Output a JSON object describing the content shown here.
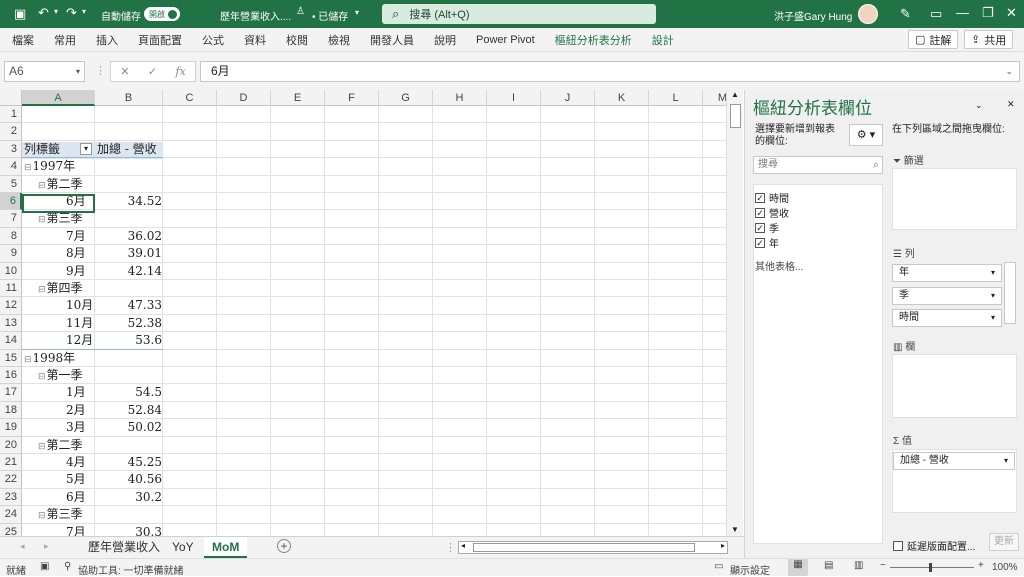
{
  "title_bar": {
    "autosave_label": "自動儲存",
    "autosave_state": "開啟",
    "doc_title": "歷年營業收入....",
    "save_status": "• 已儲存",
    "search_placeholder": "搜尋 (Alt+Q)",
    "user_name": "洪子盛Gary Hung"
  },
  "menu": {
    "items": [
      "檔案",
      "常用",
      "插入",
      "頁面配置",
      "公式",
      "資料",
      "校閱",
      "檢視",
      "開發人員",
      "說明",
      "Power Pivot",
      "樞紐分析表分析",
      "設計"
    ],
    "comment_label": "註解",
    "share_label": "共用"
  },
  "formula_bar": {
    "name_box": "A6",
    "fx_label": "fx",
    "formula_value": "6月"
  },
  "grid": {
    "columns": [
      "A",
      "B",
      "C",
      "D",
      "E",
      "F",
      "G",
      "H",
      "I",
      "J",
      "K",
      "L",
      "M"
    ],
    "rows": [
      "1",
      "2",
      "3",
      "4",
      "5",
      "6",
      "7",
      "8",
      "9",
      "10",
      "11",
      "12",
      "13",
      "14",
      "15",
      "16",
      "17",
      "18",
      "19",
      "20",
      "21",
      "22",
      "23",
      "24",
      "25"
    ],
    "cells": [
      {
        "r": 3,
        "col": "a",
        "text": "列標籤",
        "kind": "header"
      },
      {
        "r": 3,
        "col": "b",
        "text": "加總 - 營收",
        "kind": "header"
      },
      {
        "r": 4,
        "col": "a",
        "text": "1997年",
        "kind": "year"
      },
      {
        "r": 5,
        "col": "a",
        "text": "第二季",
        "kind": "quarter"
      },
      {
        "r": 6,
        "col": "a",
        "text": "6月",
        "kind": "month"
      },
      {
        "r": 6,
        "col": "b",
        "text": "34.52",
        "kind": "value"
      },
      {
        "r": 7,
        "col": "a",
        "text": "第三季",
        "kind": "quarter"
      },
      {
        "r": 8,
        "col": "a",
        "text": "7月",
        "kind": "month"
      },
      {
        "r": 8,
        "col": "b",
        "text": "36.02",
        "kind": "value"
      },
      {
        "r": 9,
        "col": "a",
        "text": "8月",
        "kind": "month"
      },
      {
        "r": 9,
        "col": "b",
        "text": "39.01",
        "kind": "value"
      },
      {
        "r": 10,
        "col": "a",
        "text": "9月",
        "kind": "month"
      },
      {
        "r": 10,
        "col": "b",
        "text": "42.14",
        "kind": "value"
      },
      {
        "r": 11,
        "col": "a",
        "text": "第四季",
        "kind": "quarter"
      },
      {
        "r": 12,
        "col": "a",
        "text": "10月",
        "kind": "month"
      },
      {
        "r": 12,
        "col": "b",
        "text": "47.33",
        "kind": "value"
      },
      {
        "r": 13,
        "col": "a",
        "text": "11月",
        "kind": "month"
      },
      {
        "r": 13,
        "col": "b",
        "text": "52.38",
        "kind": "value"
      },
      {
        "r": 14,
        "col": "a",
        "text": "12月",
        "kind": "month"
      },
      {
        "r": 14,
        "col": "b",
        "text": "53.6",
        "kind": "value"
      },
      {
        "r": 15,
        "col": "a",
        "text": "1998年",
        "kind": "year"
      },
      {
        "r": 16,
        "col": "a",
        "text": "第一季",
        "kind": "quarter"
      },
      {
        "r": 17,
        "col": "a",
        "text": "1月",
        "kind": "month"
      },
      {
        "r": 17,
        "col": "b",
        "text": "54.5",
        "kind": "value"
      },
      {
        "r": 18,
        "col": "a",
        "text": "2月",
        "kind": "month"
      },
      {
        "r": 18,
        "col": "b",
        "text": "52.84",
        "kind": "value"
      },
      {
        "r": 19,
        "col": "a",
        "text": "3月",
        "kind": "month"
      },
      {
        "r": 19,
        "col": "b",
        "text": "50.02",
        "kind": "value"
      },
      {
        "r": 20,
        "col": "a",
        "text": "第二季",
        "kind": "quarter"
      },
      {
        "r": 21,
        "col": "a",
        "text": "4月",
        "kind": "month"
      },
      {
        "r": 21,
        "col": "b",
        "text": "45.25",
        "kind": "value"
      },
      {
        "r": 22,
        "col": "a",
        "text": "5月",
        "kind": "month"
      },
      {
        "r": 22,
        "col": "b",
        "text": "40.56",
        "kind": "value"
      },
      {
        "r": 23,
        "col": "a",
        "text": "6月",
        "kind": "month"
      },
      {
        "r": 23,
        "col": "b",
        "text": "30.2",
        "kind": "value"
      },
      {
        "r": 24,
        "col": "a",
        "text": "第三季",
        "kind": "quarter"
      },
      {
        "r": 25,
        "col": "a",
        "text": "7月",
        "kind": "month"
      },
      {
        "r": 25,
        "col": "b",
        "text": "30.3",
        "kind": "value"
      }
    ]
  },
  "sheets": {
    "tabs": [
      "歷年營業收入",
      "YoY",
      "MoM"
    ],
    "active": "MoM"
  },
  "status_bar": {
    "mode": "就緒",
    "accessibility": "協助工具: 一切準備就緒",
    "display_settings": "顯示設定",
    "zoom": "100%"
  },
  "pivot_pane": {
    "title": "樞紐分析表欄位",
    "choose_label": "選擇要新增到報表的欄位:",
    "search_placeholder": "搜尋",
    "fields": [
      {
        "name": "時間",
        "checked": true
      },
      {
        "name": "營收",
        "checked": true
      },
      {
        "name": "季",
        "checked": true
      },
      {
        "name": "年",
        "checked": true
      }
    ],
    "more_tables": "其他表格...",
    "drag_label": "在下列區域之間拖曳欄位:",
    "filter_label": "篩選",
    "columns_label": "列",
    "column_items": [
      "年",
      "季",
      "時間"
    ],
    "rows_label": "欄",
    "values_label": "值",
    "value_items": [
      "加總 - 營收"
    ],
    "defer_label": "延遲版面配置...",
    "update_label": "更新"
  }
}
